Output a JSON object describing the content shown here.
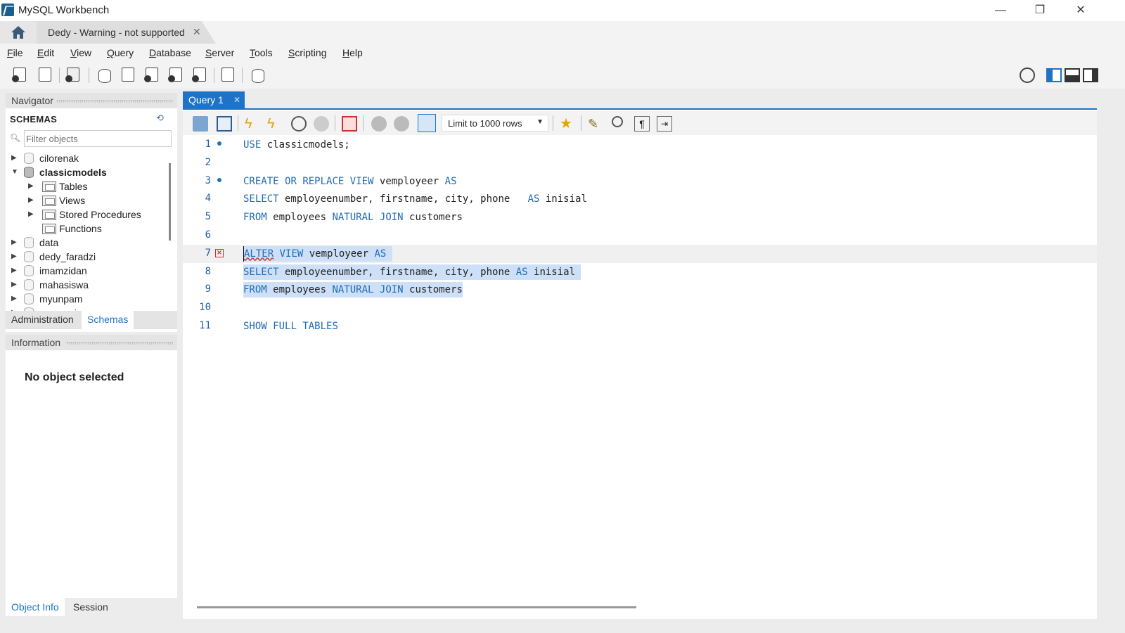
{
  "window": {
    "title": "MySQL Workbench",
    "minimize": "—",
    "restore": "❐",
    "close": "✕"
  },
  "connection_tab": {
    "label": "Dedy - Warning - not supported",
    "close": "✕"
  },
  "menu": [
    "File",
    "Edit",
    "View",
    "Query",
    "Database",
    "Server",
    "Tools",
    "Scripting",
    "Help"
  ],
  "navigator": {
    "header": "Navigator",
    "schemas_title": "SCHEMAS",
    "filter_placeholder": "Filter objects",
    "tree": [
      {
        "label": "cilorenak",
        "expanded": false,
        "level": 0
      },
      {
        "label": "classicmodels",
        "expanded": true,
        "bold": true,
        "level": 0
      },
      {
        "label": "Tables",
        "level": 1,
        "has_arrow": true
      },
      {
        "label": "Views",
        "level": 1,
        "has_arrow": true
      },
      {
        "label": "Stored Procedures",
        "level": 1,
        "has_arrow": true
      },
      {
        "label": "Functions",
        "level": 1,
        "has_arrow": false
      },
      {
        "label": "data",
        "level": 0
      },
      {
        "label": "dedy_faradzi",
        "level": 0
      },
      {
        "label": "imamzidan",
        "level": 0
      },
      {
        "label": "mahasiswa",
        "level": 0
      },
      {
        "label": "myunpam",
        "level": 0
      },
      {
        "label": "persensi",
        "level": 0
      }
    ],
    "tabs": {
      "administration": "Administration",
      "schemas": "Schemas"
    }
  },
  "information": {
    "header": "Information",
    "message": "No object selected",
    "tabs": {
      "object_info": "Object Info",
      "session": "Session"
    }
  },
  "query_tab": {
    "label": "Query 1",
    "close": "✕"
  },
  "sql_toolbar": {
    "limit": "Limit to 1000 rows"
  },
  "editor": {
    "lines": [
      {
        "n": "1",
        "marker": "dot",
        "tokens": [
          [
            "kw",
            "USE"
          ],
          [
            "t",
            " classicmodels;"
          ]
        ]
      },
      {
        "n": "2",
        "tokens": []
      },
      {
        "n": "3",
        "marker": "dot",
        "tokens": [
          [
            "kw",
            "CREATE"
          ],
          [
            "t",
            " "
          ],
          [
            "kw",
            "OR"
          ],
          [
            "t",
            " "
          ],
          [
            "kw",
            "REPLACE"
          ],
          [
            "t",
            " "
          ],
          [
            "kw",
            "VIEW"
          ],
          [
            "t",
            " vemployeer "
          ],
          [
            "kw",
            "AS"
          ]
        ]
      },
      {
        "n": "4",
        "tokens": [
          [
            "kw",
            "SELECT"
          ],
          [
            "t",
            " employeenumber, firstname, city, phone   "
          ],
          [
            "kw",
            "AS"
          ],
          [
            "t",
            " inisial"
          ]
        ]
      },
      {
        "n": "5",
        "tokens": [
          [
            "kw",
            "FROM"
          ],
          [
            "t",
            " employees "
          ],
          [
            "kw",
            "NATURAL"
          ],
          [
            "t",
            " "
          ],
          [
            "kw",
            "JOIN"
          ],
          [
            "t",
            " customers"
          ]
        ]
      },
      {
        "n": "6",
        "tokens": []
      },
      {
        "n": "7",
        "marker": "error",
        "selected": true,
        "current": true,
        "tokens": [
          [
            "kw",
            "ALTER"
          ],
          [
            "t",
            " "
          ],
          [
            "kw",
            "VIEW"
          ],
          [
            "t",
            " vemployeer "
          ],
          [
            "kw",
            "AS"
          ],
          [
            "t",
            " "
          ]
        ]
      },
      {
        "n": "8",
        "selected": true,
        "tokens": [
          [
            "kw",
            "SELECT"
          ],
          [
            "t",
            " employeenumber, firstname, city, phone "
          ],
          [
            "kw",
            "AS"
          ],
          [
            "t",
            " inisial "
          ]
        ]
      },
      {
        "n": "9",
        "selected": true,
        "tokens": [
          [
            "kw",
            "FROM"
          ],
          [
            "t",
            " employees "
          ],
          [
            "kw",
            "NATURAL"
          ],
          [
            "t",
            " "
          ],
          [
            "kw",
            "JOIN"
          ],
          [
            "t",
            " customers"
          ]
        ]
      },
      {
        "n": "10",
        "tokens": []
      },
      {
        "n": "11",
        "tokens": [
          [
            "kw",
            "SHOW"
          ],
          [
            "t",
            " "
          ],
          [
            "kw",
            "FULL"
          ],
          [
            "t",
            " "
          ],
          [
            "kw",
            "TABLES"
          ]
        ]
      }
    ]
  }
}
